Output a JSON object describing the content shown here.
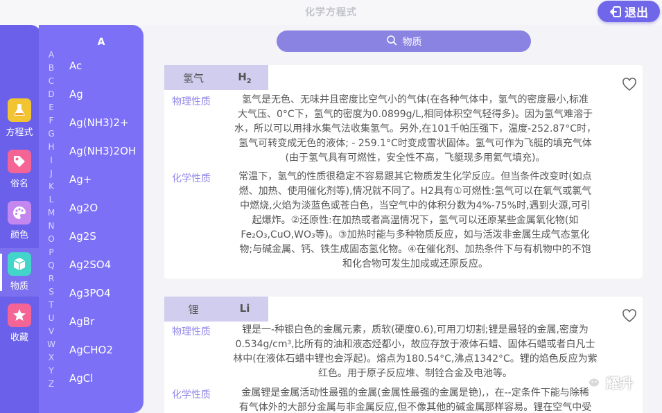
{
  "app": {
    "title": "化学方程式",
    "exit_label": "退出"
  },
  "colors": {
    "primary": "#6b60ea",
    "panel": "#7c70f6",
    "search": "#8b83e2",
    "accent_text": "#8e84e8"
  },
  "tabs": [
    {
      "label": "方程式",
      "icon": "flask-icon",
      "color": "#f3c431"
    },
    {
      "label": "俗名",
      "icon": "tag-icon",
      "color": "#f46495"
    },
    {
      "label": "颜色",
      "icon": "palette-icon",
      "color": "#c487f0"
    },
    {
      "label": "物质",
      "icon": "cube-icon",
      "color": "#43d5c9",
      "active": true
    },
    {
      "label": "收藏",
      "icon": "star-icon",
      "color": "#f46495"
    }
  ],
  "formula_list": {
    "header": "A",
    "items": [
      "Ac",
      "Ag",
      "Ag(NH3)2+",
      "Ag(NH3)2OH",
      "Ag+",
      "Ag2O",
      "Ag2S",
      "Ag2SO4",
      "Ag3PO4",
      "AgBr",
      "AgCHO2",
      "AgCl"
    ],
    "letters": [
      "A",
      "B",
      "C",
      "D",
      "E",
      "F",
      "G",
      "H",
      "I",
      "J",
      "K",
      "L",
      "M",
      "N",
      "O",
      "P",
      "Q",
      "R",
      "S",
      "T",
      "U",
      "V",
      "W",
      "X",
      "Y",
      "Z"
    ]
  },
  "search": {
    "placeholder": "物质",
    "icon": "search-icon"
  },
  "substances": [
    {
      "name": "氢气",
      "symbol": "H",
      "symbol_sub": "2",
      "phys_label": "物理性质",
      "phys_lines": [
        "氢气是无色、无味并且密度比空气小的气体(在各种气体中，氢气的密度最小,标准",
        "大气压、0°C下，氢气的密度为0.0899g/L,相同体积空气轻得多)。因为氢气难溶于",
        "水，所以可以用排水集气法收集氢气。另外,在101千帕压强下，温度-252.87°C时，",
        "氢气可转变成无色的液体; - 259.1°C时变成雪状固体。氢气可作为飞艇的填充气体",
        "(由于氢气具有可燃性，安全性不高，飞艇现多用氦气填充)。"
      ],
      "chem_label": "化学性质",
      "chem_lines": [
        "常温下，氢气的性质很稳定不容易跟其它物质发生化学反应。但当条件改变时(如点",
        "燃、加热、使用催化剂等),情况就不同了。H2具有①可燃性:氢气可以在氧气或氯气",
        "中燃烧,火焰为淡蓝色或苍白色，当空气中的体积分数为4%-75%时,遇到火源,可引",
        "起爆炸。②还原性:在加热或者高温情况下，氢气可以还原某些金属氧化物(如",
        "Fe₂O₃,CuO,WO₃等)。③加热时能与多种物质反应，如与活泼非金属生成气态氢化",
        "物;与碱金属、钙、铁生成固态氢化物。④在催化剂、加热条件下与有机物中的不饱",
        "和化合物可发生加成或还原反应。"
      ]
    },
    {
      "name": "锂",
      "symbol": "Li",
      "symbol_sub": "",
      "phys_label": "物理性质",
      "phys_lines": [
        "锂是一-种银白色的金属元素，质软(硬度0.6),可用刀切割;锂是最轻的金属,密度为",
        "0.534g/cm³,比所有的油和液态烃都小，故应存放于液体石蜡、固体石蜡或者白凡士",
        "林中(在液体石蜡中锂也会浮起)。熔点为180.54°C,沸点1342°C。锂的焰色反应为紫",
        "红色。用于原子反应堆、制铨合金及电池等。"
      ],
      "chem_label": "化学性质",
      "chem_lines": [
        "金属锂是金属活动性最强的金属(金属性最强的金属是铯),，在--定条件下能与除稀",
        "有气体外的大部分金属与非金属反应,但不像其他的碱金属那样容易。锂在空气中受"
      ]
    }
  ],
  "watermark": {
    "text": "耀升",
    "icon": "wechat-icon"
  }
}
